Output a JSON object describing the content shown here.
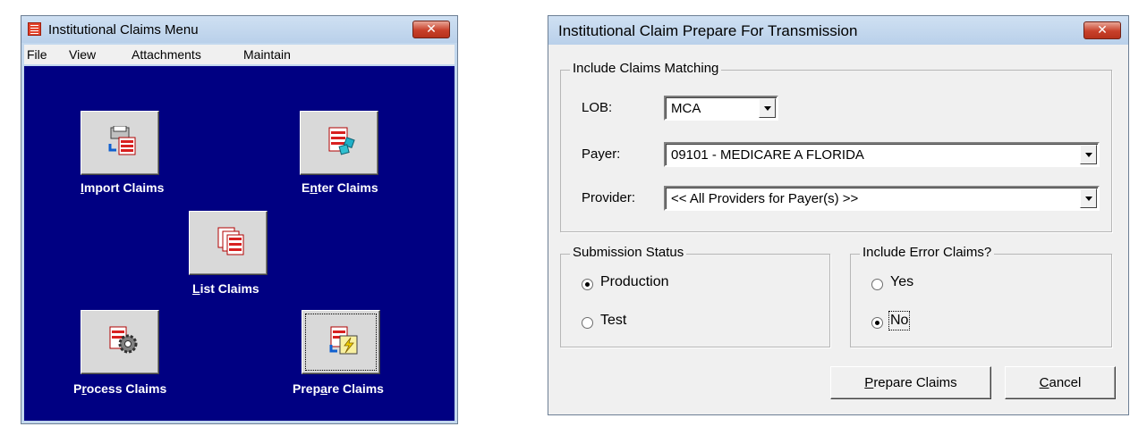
{
  "menu_window": {
    "title": "Institutional Claims Menu",
    "close_glyph": "✕",
    "menubar": [
      "File",
      "View",
      "Attachments",
      "Maintain"
    ],
    "buttons": {
      "import": {
        "pre": "",
        "key": "I",
        "post": "mport Claims",
        "icon": "import-claims-icon"
      },
      "enter": {
        "pre": "E",
        "key": "n",
        "post": "ter Claims",
        "icon": "enter-claims-icon"
      },
      "list": {
        "pre": "",
        "key": "L",
        "post": "ist Claims",
        "icon": "list-claims-icon"
      },
      "process": {
        "pre": "P",
        "key": "r",
        "post": "ocess Claims",
        "icon": "process-claims-icon"
      },
      "prepare": {
        "pre": "Prep",
        "key": "a",
        "post": "re Claims",
        "icon": "prepare-claims-icon"
      }
    }
  },
  "prepare_dialog": {
    "title": "Institutional Claim Prepare For Transmission",
    "close_glyph": "✕",
    "include_group": {
      "label": "Include Claims Matching",
      "lob_label": "LOB:",
      "lob_value": "MCA",
      "payer_label": "Payer:",
      "payer_value": "09101 - MEDICARE A FLORIDA",
      "provider_label": "Provider:",
      "provider_value": "<< All Providers for Payer(s) >>"
    },
    "submission_group": {
      "label": "Submission Status",
      "options": [
        {
          "label": "Production",
          "checked": true
        },
        {
          "label": "Test",
          "checked": false
        }
      ]
    },
    "error_group": {
      "label": "Include Error Claims?",
      "options": [
        {
          "label": "Yes",
          "checked": false
        },
        {
          "label": "No",
          "checked": true
        }
      ]
    },
    "prepare_button": {
      "key": "P",
      "rest": "repare Claims"
    },
    "cancel_button": {
      "key": "C",
      "rest": "ancel"
    }
  }
}
